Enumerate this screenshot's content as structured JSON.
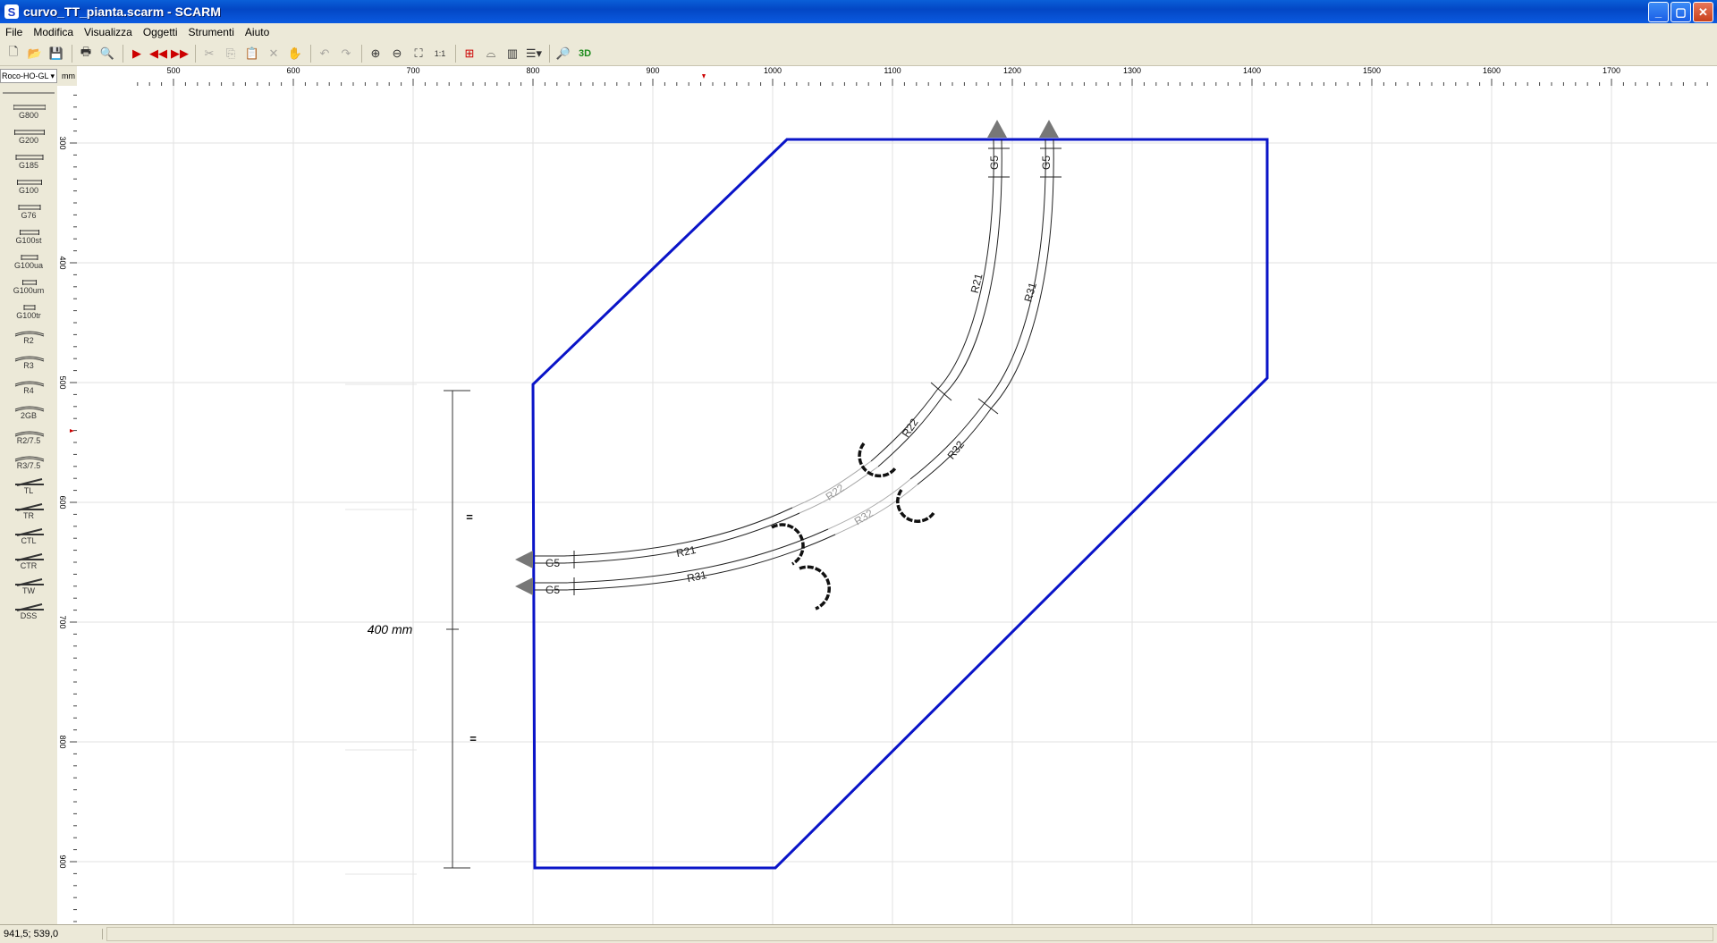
{
  "window": {
    "title": "curvo_TT_pianta.scarm - SCARM"
  },
  "menu": {
    "items": [
      "File",
      "Modifica",
      "Visualizza",
      "Oggetti",
      "Strumenti",
      "Aiuto"
    ]
  },
  "toolbar": {
    "buttons": [
      "new-file-icon",
      "open-folder-icon",
      "save-icon",
      "print-icon",
      "print-preview-icon",
      "select-arrow-icon",
      "prev-track-icon",
      "next-track-icon",
      "cut-icon",
      "copy-icon",
      "paste-icon",
      "delete-icon",
      "hand-icon",
      "undo-icon",
      "redo-icon",
      "zoom-in-icon",
      "zoom-out-icon",
      "zoom-fit-icon",
      "zoom-1to1-icon",
      "measure-icon",
      "bridge-icon",
      "tunnel-icon",
      "layers-icon",
      "find-icon",
      "3d-view-icon"
    ]
  },
  "palette": {
    "selected": "Roco-HO-GL",
    "items": [
      "G800",
      "G200",
      "G185",
      "G100",
      "G76",
      "G100st",
      "G100ua",
      "G100um",
      "G100tr",
      "R2",
      "R3",
      "R4",
      "2GB",
      "R2/7.5",
      "R3/7.5",
      "TL",
      "TR",
      "CTL",
      "CTR",
      "TW",
      "DSS"
    ]
  },
  "ruler": {
    "unit": "mm",
    "x_labels": [
      "500",
      "600",
      "700",
      "800",
      "900",
      "1000",
      "1100",
      "1200",
      "1300",
      "1400",
      "1500",
      "1600",
      "1700"
    ],
    "y_labels": [
      "300",
      "400",
      "500",
      "600",
      "700",
      "800",
      "900"
    ]
  },
  "canvas": {
    "dimension_label": "400 mm",
    "dimension_eq_1": "=",
    "dimension_eq_2": "=",
    "track_labels": {
      "g5_top_left": "G5",
      "g5_top_right": "G5",
      "g5_left_top": "G5",
      "g5_left_bottom": "G5",
      "r21_upper": "R21",
      "r31_upper": "R31",
      "r22_upper": "R22",
      "r32_upper": "R32",
      "r22_ghost": "R22",
      "r32_ghost": "R32",
      "r21_lower": "R21",
      "r31_lower": "R31"
    }
  },
  "status": {
    "coords": "941,5; 539,0"
  },
  "colors": {
    "border_line": "#0a14c8",
    "track": "#222222"
  }
}
